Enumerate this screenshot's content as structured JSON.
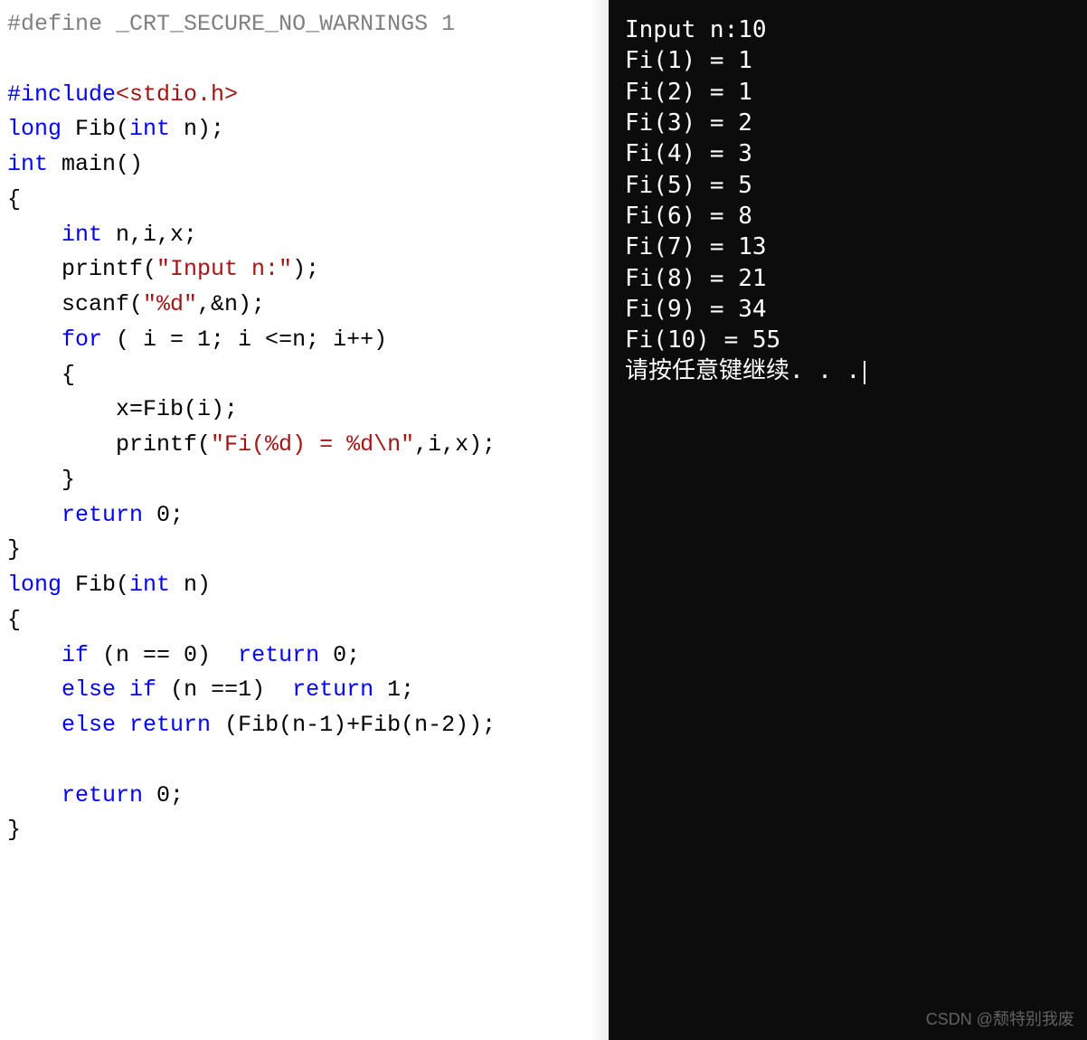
{
  "code": {
    "define_kw": "#define",
    "define_rest": " _CRT_SECURE_NO_WARNINGS 1",
    "include_kw": "#include",
    "include_path": "<stdio.h>",
    "long_kw": "long",
    "fib_decl_name": " Fib(",
    "int_kw": "int",
    "fib_decl_param": " n);",
    "main_name": " main()",
    "lbrace": "{",
    "decl_vars": "    ",
    "vars_rest": " n,i,x;",
    "printf1_pre": "    printf(",
    "printf1_str": "\"Input n:\"",
    "printf1_post": ");",
    "scanf_pre": "    scanf(",
    "scanf_str": "\"%d\"",
    "scanf_post": ",&n);",
    "for_kw": "for",
    "for_pre": "    ",
    "for_body": " ( i = 1; i <=n; i++)",
    "for_lbrace": "    {",
    "assign_x": "        x=Fib(i);",
    "printf2_pre": "        printf(",
    "printf2_str": "\"Fi(%d) = %d\\n\"",
    "printf2_post": ",i,x);",
    "for_rbrace": "    }",
    "return_kw": "return",
    "return0_pre": "    ",
    "return0_post": " 0;",
    "rbrace": "}",
    "fib_def_pre": " Fib(",
    "fib_def_param": " n)",
    "if_kw": "if",
    "if_pre": "    ",
    "if_cond": " (n == 0)  ",
    "if_ret": " 0;",
    "else_kw": "else",
    "elseif_pre": "    ",
    "elseif_mid": " ",
    "elseif_cond": " (n ==1)  ",
    "elseif_ret": " 1;",
    "else_pre": "    ",
    "else_ret": " (Fib(n-1)+Fib(n-2));",
    "return_last_pre": "    ",
    "return_last_post": " 0;"
  },
  "terminal": {
    "lines": [
      "Input n:10",
      "Fi(1) = 1",
      "Fi(2) = 1",
      "Fi(3) = 2",
      "Fi(4) = 3",
      "Fi(5) = 5",
      "Fi(6) = 8",
      "Fi(7) = 13",
      "Fi(8) = 21",
      "Fi(9) = 34",
      "Fi(10) = 55",
      "请按任意键继续. . ."
    ]
  },
  "watermark": "CSDN @颓特别我废"
}
